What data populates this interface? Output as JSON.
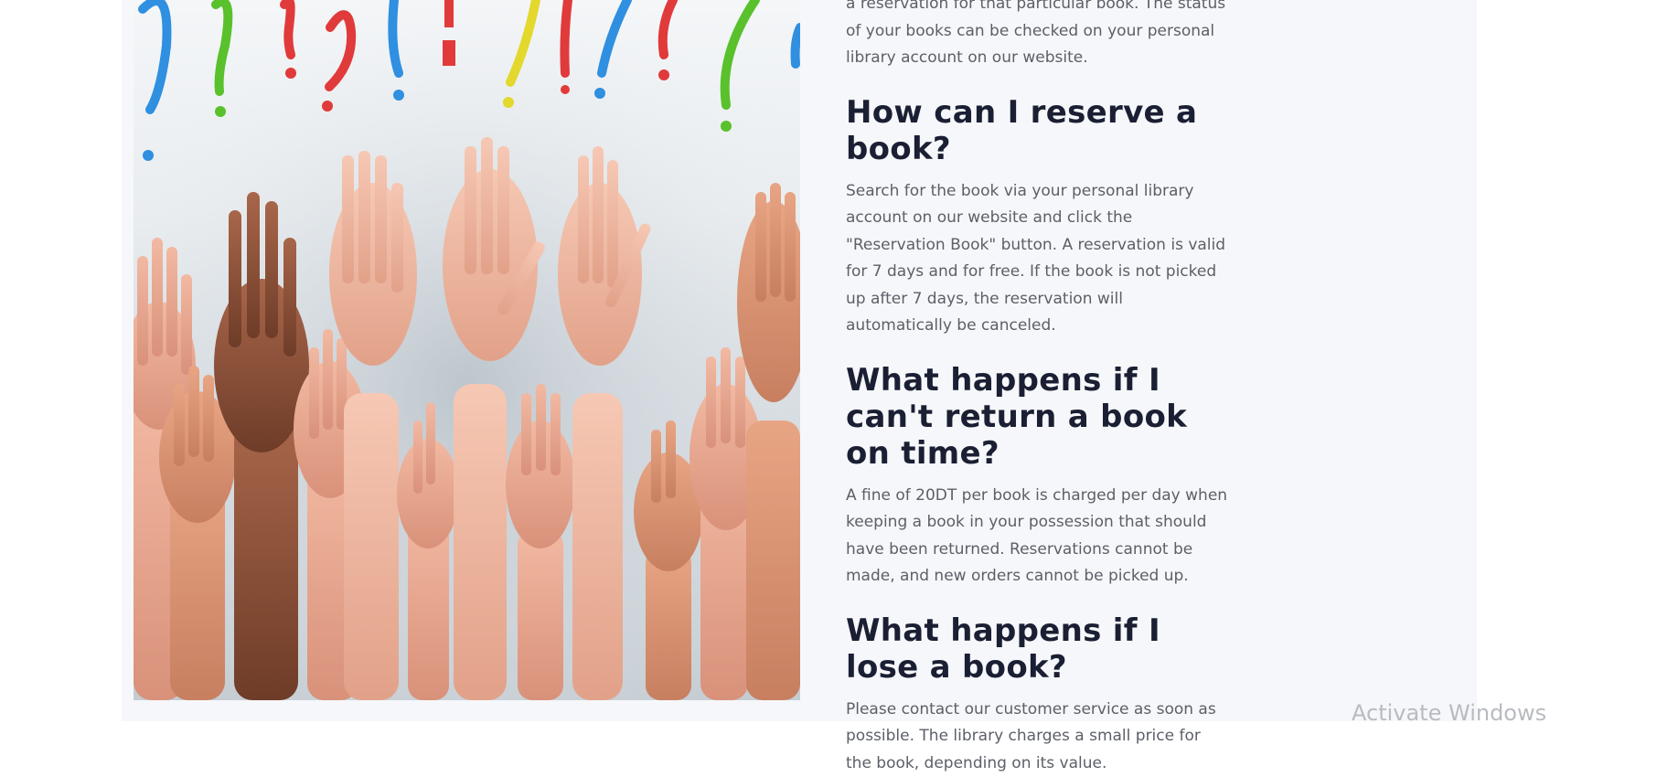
{
  "faq": {
    "intro_text": "a reservation for that particular book. The status of your books can be checked on your personal library account on our website.",
    "items": [
      {
        "question": "How can I reserve a book?",
        "answer": "Search for the book via your personal library account on our website and click the \"Reservation Book\" button. A reservation is valid for 7 days and for free. If the book is not picked up after 7 days, the reservation will automatically be canceled."
      },
      {
        "question": "What happens if I can't return a book on time?",
        "answer": "A fine of 20DT per book is charged per day when keeping a book in your possession that should have been returned. Reservations cannot be made, and new orders cannot be picked up."
      },
      {
        "question": "What happens if I lose a book?",
        "answer": "Please contact our customer service as soon as possible. The library charges a small price for the book, depending on its value."
      }
    ]
  },
  "watermark": {
    "text": "Activate Windows"
  },
  "colors": {
    "section_background": "#f6f7fa",
    "heading": "#1a1f33",
    "body_text": "#5b5f68"
  }
}
